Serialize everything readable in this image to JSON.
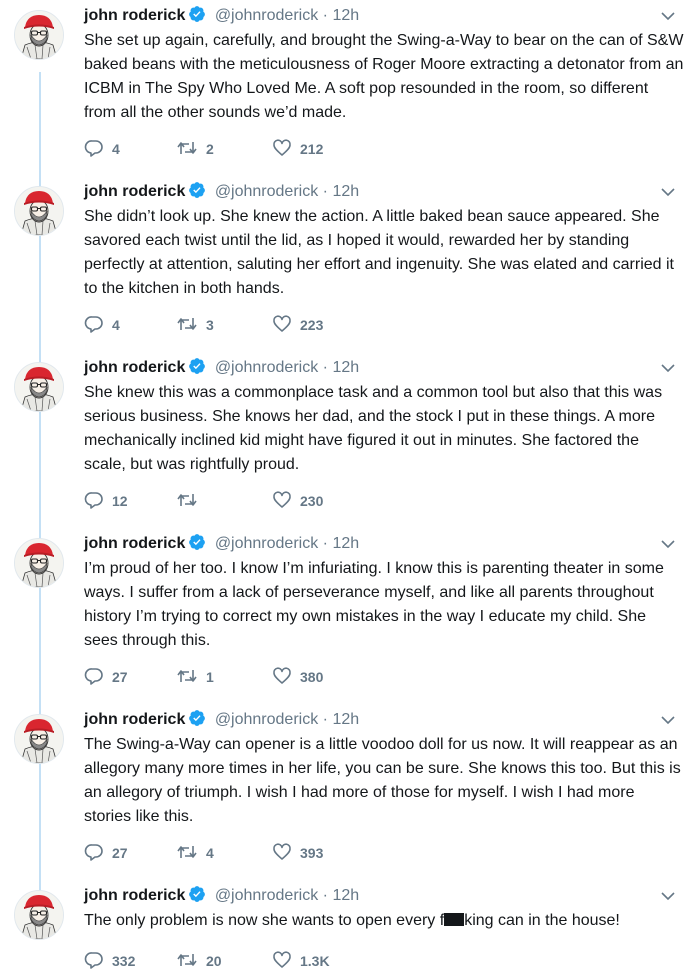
{
  "author": {
    "name": "john roderick",
    "handle": "@johnroderick",
    "separator": "·",
    "time": "12h"
  },
  "colors": {
    "thread_line": "#c4e0f5",
    "verified": "#1da1f2",
    "secondary_text": "#657786",
    "hat": "#d9262f"
  },
  "tweets": [
    {
      "text": "She set up again, carefully, and brought the Swing-a-Way to bear on the can of S&W baked beans with the meticulousness of Roger Moore extracting a detonator from an ICBM in The Spy Who Loved Me. A soft pop resounded in the room, so different from all the other sounds we’d made.",
      "replies": "4",
      "retweets": "2",
      "likes": "212"
    },
    {
      "text": "She didn’t look up. She knew the action. A little baked bean sauce appeared. She savored each twist until the lid, as I hoped it would, rewarded her by standing perfectly at attention, saluting her effort and ingenuity. She was elated and carried it to the kitchen in both hands.",
      "replies": "4",
      "retweets": "3",
      "likes": "223"
    },
    {
      "text": "She knew this was a commonplace task and a common tool but also that this was serious business. She knows her dad, and the stock I put in these things. A more mechanically inclined kid might have figured it out in minutes. She factored the scale, but was rightfully proud.",
      "replies": "12",
      "retweets": "",
      "likes": "230"
    },
    {
      "text": "I’m proud of her too. I know I’m infuriating. I know this is parenting theater in some ways. I suffer from a lack of perseverance myself, and like all parents throughout history I’m trying to correct my own mistakes in the way I educate my child. She sees through this.",
      "replies": "27",
      "retweets": "1",
      "likes": "380"
    },
    {
      "text": "The Swing-a-Way can opener is a little voodoo doll for us now. It will reappear as an allegory many more times in her life, you can be sure. She knows this too. But this is an allegory of triumph. I wish I had more of those for myself. I wish I had more stories like this.",
      "replies": "27",
      "retweets": "4",
      "likes": "393"
    },
    {
      "text_before": "The only problem is now she wants to open every f",
      "text_after": "king can in the house!",
      "replies": "332",
      "retweets": "20",
      "likes": "1.3K"
    }
  ]
}
